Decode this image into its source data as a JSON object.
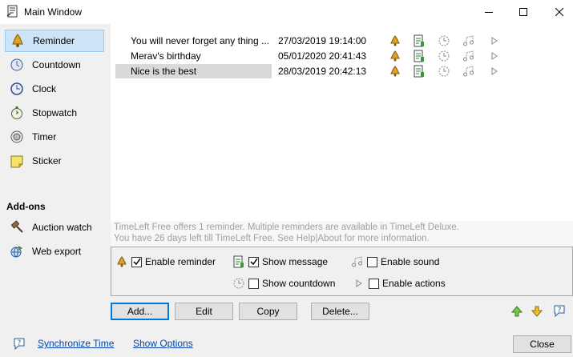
{
  "window": {
    "title": "Main Window"
  },
  "sidebar": {
    "items": [
      {
        "label": "Reminder",
        "icon": "bell-icon"
      },
      {
        "label": "Countdown",
        "icon": "countdown-icon"
      },
      {
        "label": "Clock",
        "icon": "clock-icon"
      },
      {
        "label": "Stopwatch",
        "icon": "stopwatch-icon"
      },
      {
        "label": "Timer",
        "icon": "timer-icon"
      },
      {
        "label": "Sticker",
        "icon": "sticker-icon"
      }
    ],
    "addons_header": "Add-ons",
    "addons": [
      {
        "label": "Auction watch",
        "icon": "gavel-icon"
      },
      {
        "label": "Web export",
        "icon": "web-export-icon"
      }
    ]
  },
  "reminders": [
    {
      "name": "You will never forget any thing ...",
      "date": "27/03/2019 19:14:00"
    },
    {
      "name": "Merav's birthday",
      "date": "05/01/2020 20:41:43"
    },
    {
      "name": "Nice is the best",
      "date": "28/03/2019 20:42:13"
    }
  ],
  "notice": {
    "line1": "TimeLeft Free offers 1 reminder. Multiple reminders are available in TimeLeft Deluxe.",
    "line2": "You have 26 days left till TimeLeft Free. See Help|About for more information."
  },
  "options": {
    "enable_reminder": "Enable reminder",
    "show_message": "Show message",
    "enable_sound": "Enable sound",
    "show_countdown": "Show countdown",
    "enable_actions": "Enable actions"
  },
  "buttons": {
    "add": "Add...",
    "edit": "Edit",
    "copy": "Copy",
    "delete": "Delete...",
    "close": "Close"
  },
  "links": {
    "sync": "Synchronize Time",
    "show_options": "Show Options"
  },
  "colors": {
    "selection": "#cce4f7",
    "link": "#0645ad",
    "bell": "#e0a020"
  }
}
